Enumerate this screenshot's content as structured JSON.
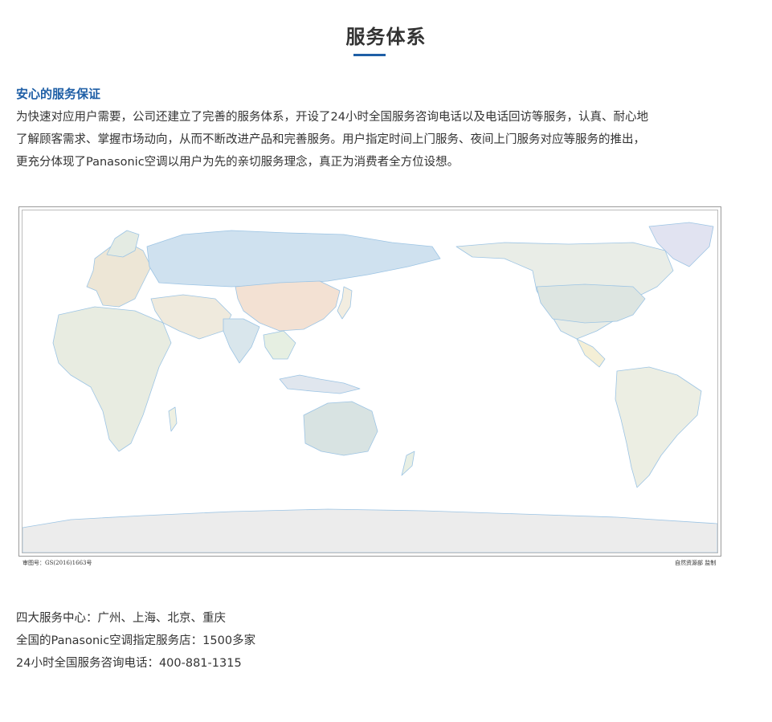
{
  "page": {
    "title": "服务体系",
    "subheading": "安心的服务保证",
    "intro_lines": [
      "为快速对应用户需要，公司还建立了完善的服务体系，开设了24小时全国服务咨询电话以及电话回访等服务，认真、耐心地",
      "了解顾客需求、掌握市场动向，从而不断改进产品和完善服务。用户指定时间上门服务、夜间上门服务对应等服务的推出，",
      "更充分体现了Panasonic空调以用户为先的亲切服务理念，真正为消费者全方位设想。"
    ]
  },
  "map": {
    "approval_number": "审图号：GS(2016)1663号",
    "publisher": "自然资源部 监制"
  },
  "service_info": [
    "四大服务中心：广州、上海、北京、重庆",
    "全国的Panasonic空调指定服务店：1500多家",
    "24小时全国服务咨询电话：400-881-1315"
  ],
  "colors": {
    "accent": "#1f5fa6",
    "text": "#333333",
    "land_neutral": "#ecebe4",
    "ocean": "#ffffff",
    "coast": "#9cc4e4"
  }
}
